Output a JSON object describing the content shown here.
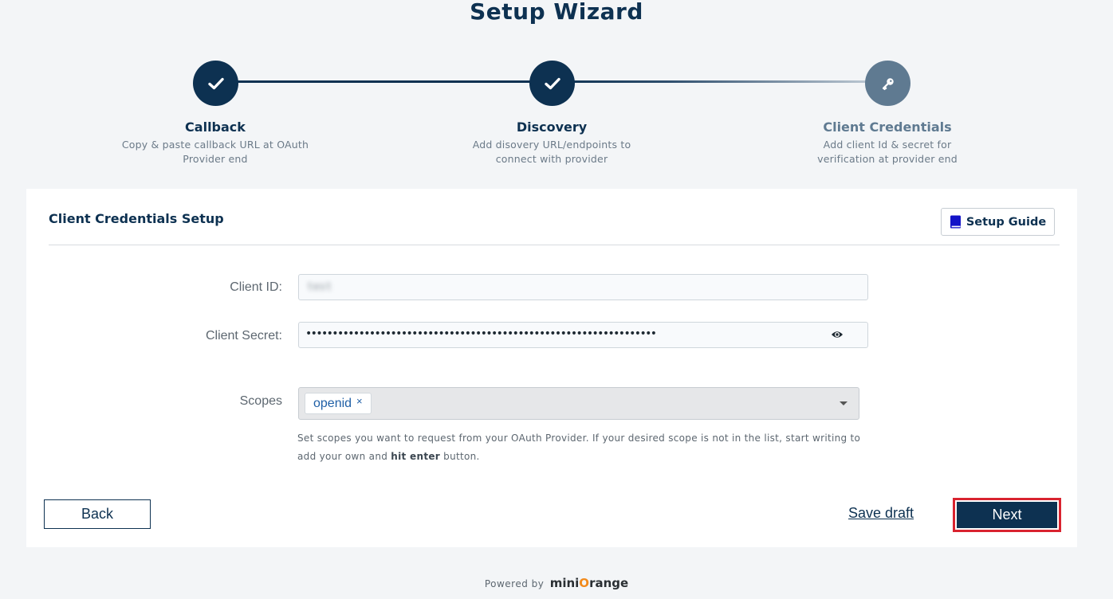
{
  "page": {
    "title": "Setup Wizard"
  },
  "steps": [
    {
      "title": "Callback",
      "description": "Copy & paste callback URL at OAuth Provider end",
      "icon": "check-icon",
      "status": "completed"
    },
    {
      "title": "Discovery",
      "description": "Add disovery URL/endpoints to connect with provider",
      "icon": "check-icon",
      "status": "completed"
    },
    {
      "title": "Client Credentials",
      "description": "Add client Id & secret for verification at provider end",
      "icon": "key-icon",
      "status": "current"
    }
  ],
  "card": {
    "title": "Client Credentials Setup",
    "guide_label": "Setup Guide"
  },
  "form": {
    "client_id_label": "Client ID:",
    "client_id_value": "test",
    "client_secret_label": "Client Secret:",
    "client_secret_value": "••••••••••••••••••••••••••••••••••••••••••••••••••••••••••••••••••",
    "scopes_label": "Scopes",
    "scope_tags": [
      "openid"
    ],
    "scope_remove": "×",
    "hint_prefix": "Set scopes you want to request from your OAuth Provider. If your desired scope is not in the list, start writing to add your own and ",
    "hint_bold": "hit enter",
    "hint_suffix": " button."
  },
  "actions": {
    "back_label": "Back",
    "save_draft_label": "Save draft",
    "next_label": "Next"
  },
  "footer": {
    "powered_by": "Powered by",
    "brand_prefix": "mini",
    "brand_o": "O",
    "brand_suffix": "range"
  },
  "colors": {
    "primary": "#0d3151",
    "inactive_step": "#5f7a91",
    "highlight_border": "#d9232f",
    "tag_text": "#1f5fa6",
    "brand_orange": "#f28a1b"
  }
}
